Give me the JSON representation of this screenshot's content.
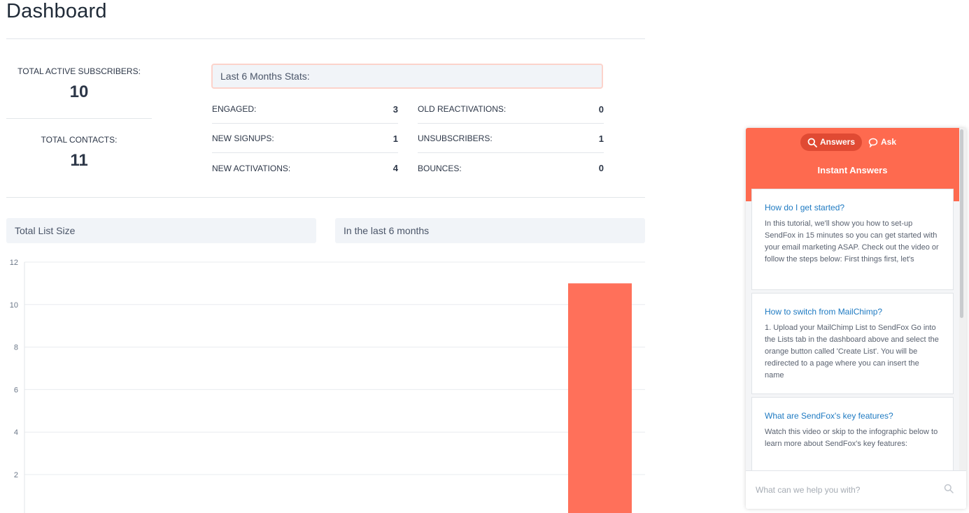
{
  "page": {
    "title": "Dashboard"
  },
  "kpis": {
    "active_label": "TOTAL ACTIVE SUBSCRIBERS:",
    "active_value": "10",
    "contacts_label": "TOTAL CONTACTS:",
    "contacts_value": "11"
  },
  "stats": {
    "header": "Last 6 Months Stats:",
    "left": [
      {
        "label": "ENGAGED:",
        "value": "3"
      },
      {
        "label": "NEW SIGNUPS:",
        "value": "1"
      },
      {
        "label": "NEW ACTIVATIONS:",
        "value": "4"
      }
    ],
    "right": [
      {
        "label": "OLD REACTIVATIONS:",
        "value": "0"
      },
      {
        "label": "UNSUBSCRIBERS:",
        "value": "1"
      },
      {
        "label": "BOUNCES:",
        "value": "0"
      }
    ]
  },
  "panels": {
    "total_list_size": "Total List Size",
    "last_6_months": "In the last 6 months"
  },
  "colors": {
    "accent": "#fe6a4f",
    "bar": "#ff705a",
    "link": "#1e7ac2"
  },
  "chart_data": {
    "type": "bar",
    "title": "",
    "y_ticks": [
      2,
      4,
      6,
      8,
      10,
      12
    ],
    "ylim": [
      0,
      12
    ],
    "values": [
      11
    ],
    "grid": true
  },
  "help_widget": {
    "tab_answers": "Answers",
    "tab_ask": "Ask",
    "title": "Instant Answers",
    "articles": [
      {
        "question": "How do I get started?",
        "excerpt": "In this tutorial, we'll show you how to set-up SendFox in 15 minutes so you can get started with your email marketing ASAP. Check out the video or follow the steps below: First things first, let's"
      },
      {
        "question": "How to switch from MailChimp?",
        "excerpt": "1. Upload your MailChimp List to SendFox Go into the Lists tab in the dashboard above and select the orange button called 'Create List'. You will be redirected to a page where you can insert the name"
      },
      {
        "question": "What are SendFox's key features?",
        "excerpt": "Watch this video or skip to the infographic below to learn more about SendFox's key features:"
      }
    ],
    "search_placeholder": "What can we help you with?"
  }
}
